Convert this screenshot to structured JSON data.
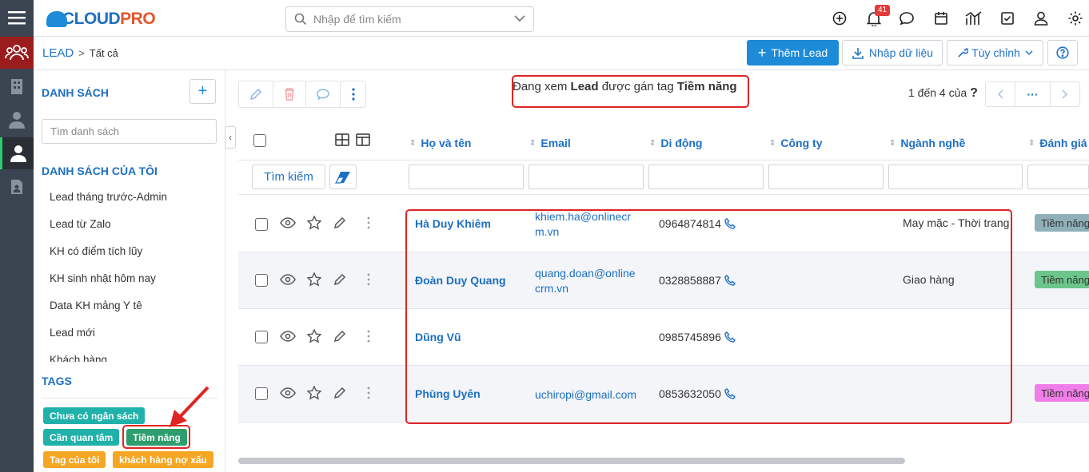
{
  "app": {
    "logo_text_1": "CLOUD",
    "logo_text_2": "PRO"
  },
  "search": {
    "placeholder": "Nhập để tìm kiếm"
  },
  "notifications": {
    "count": "41"
  },
  "breadcrumb": {
    "module": "LEAD",
    "current": "Tất cả"
  },
  "header_buttons": {
    "add": "Thêm Lead",
    "import": "Nhập dữ liệu",
    "customize": "Tùy chỉnh"
  },
  "sidebar": {
    "list_title": "DANH SÁCH",
    "search_placeholder": "Tìm danh sách",
    "my_lists_title": "DANH SÁCH CỦA TÔI",
    "items": [
      "Lead tháng trước-Admin",
      "Lead từ Zalo",
      "KH có điểm tích lũy",
      "KH sinh nhật hôm nay",
      "Data KH mảng Y tê",
      "Lead mới",
      "Khách hàng"
    ],
    "tags_title": "TAGS",
    "tags": [
      {
        "label": "Chưa có ngân sách",
        "color": "#20b2aa"
      },
      {
        "label": "Cần quan tâm",
        "color": "#20b2aa"
      },
      {
        "label": "Tiềm năng",
        "color": "#2e9e6e"
      },
      {
        "label": "Tag của tôi",
        "color": "#f5a623"
      },
      {
        "label": "khách hàng nợ xấu",
        "color": "#f5a623"
      }
    ]
  },
  "info": {
    "prefix": "Đang xem",
    "module": "Lead",
    "middle": "được gán tag",
    "tag": "Tiềm năng"
  },
  "pager": {
    "text": "1 đến 4 của",
    "help": "?",
    "more": "···"
  },
  "table": {
    "columns": [
      "Họ và tên",
      "Email",
      "Di động",
      "Công ty",
      "Ngành nghề",
      "Đánh giá"
    ],
    "search_button": "Tìm kiếm",
    "rows": [
      {
        "name": "Hà Duy Khiêm",
        "email_1": "khiem.ha@onlinecr",
        "email_2": "m.vn",
        "phone": "0964874814",
        "company": "",
        "industry": "May mặc - Thời trang",
        "tag": "Tiềm năng",
        "tag_color": "#8fb0b8"
      },
      {
        "name": "Đoàn Duy Quang",
        "email_1": "quang.doan@online",
        "email_2": "crm.vn",
        "phone": "0328858887",
        "company": "",
        "industry": "Giao hàng",
        "tag": "Tiềm năng",
        "tag_color": "#6cc58a"
      },
      {
        "name": "Dũng Vũ",
        "email_1": "",
        "email_2": "",
        "phone": "0985745896",
        "company": "",
        "industry": "",
        "tag": "",
        "tag_color": ""
      },
      {
        "name": "Phùng Uyên",
        "email_1": "uchiropi@gmail.com",
        "email_2": "",
        "phone": "0853632050",
        "company": "",
        "industry": "",
        "tag": "Tiềm năng",
        "tag_color": "#f07ee8"
      }
    ]
  },
  "colors": {
    "accent": "#1d8bd8",
    "sidebar_dark": "#3b4451",
    "active_module": "#9b1c1c",
    "highlight": "#e02424"
  },
  "icons": [
    "menu-icon",
    "users-icon",
    "building-icon",
    "contact-icon",
    "person-icon",
    "document-icon",
    "search-icon",
    "plus-circle-icon",
    "bell-icon",
    "chat-icon",
    "calendar-icon",
    "chart-icon",
    "task-icon",
    "user-icon",
    "gear-icon"
  ]
}
